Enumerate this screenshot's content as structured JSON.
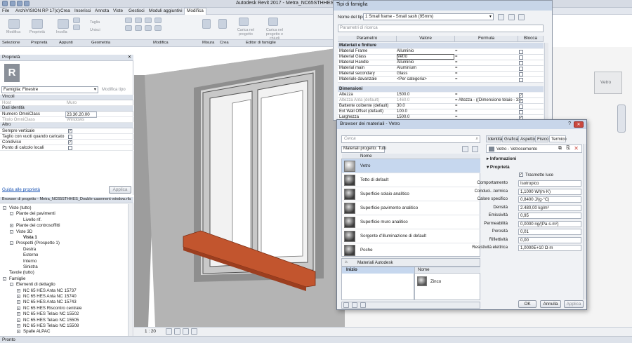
{
  "window": {
    "title": "Autodesk Revit 2017 -",
    "file_title": "Metra_NC65STHHES_Double-casement"
  },
  "menu_tabs": [
    "File",
    "ArchiVISION RP 17(c)",
    "Crea",
    "Inserisci",
    "Annota",
    "Viste",
    "Gestisci",
    "Moduli aggiuntivi",
    "Modifica"
  ],
  "ribbon": {
    "buttons": [
      "Modifica",
      "Proprietà",
      "Incolla",
      "Taglia",
      "Unisci",
      "Carica nel progetto",
      "Carica nel progetto e chiudi"
    ],
    "panels": [
      "Selezione",
      "Proprietà",
      "Appunti",
      "Geometria",
      "Modifica",
      "Misura",
      "Crea",
      "Editor di famiglie"
    ]
  },
  "properties": {
    "header": "Proprietà",
    "family_selector": "Famiglia: Finestre",
    "edit_type": "Modifica tipo",
    "groups": {
      "vincoli": "Vincoli",
      "dati": "Dati identità",
      "altro": "Altro"
    },
    "rows": {
      "host": {
        "label": "Host",
        "value": "Muro"
      },
      "numero": {
        "label": "Numero OmniClass",
        "value": "23.30.20.00"
      },
      "titolo": {
        "label": "Titolo OmniClass",
        "value": "Windows"
      },
      "sempre": {
        "label": "Sempre verticale",
        "checked": true
      },
      "taglio": {
        "label": "Taglio con vuoti quando caricato",
        "checked": false
      },
      "condiviso": {
        "label": "Condiviso",
        "checked": true
      },
      "punto": {
        "label": "Punto di calcolo locali",
        "checked": false
      }
    },
    "help_link": "Guida alle proprietà",
    "apply": "Applica"
  },
  "project_browser": {
    "header": "Browser di progetto - Metra_NC65STHHES_Double-casement-window.rfa",
    "items": [
      {
        "label": "Viste (tutto)",
        "indent": 0,
        "toggle": "-"
      },
      {
        "label": "Piante dei pavimenti",
        "indent": 1,
        "toggle": "-"
      },
      {
        "label": "Livello rif.",
        "indent": 2,
        "toggle": ""
      },
      {
        "label": "Piante dei controsoffitti",
        "indent": 1,
        "toggle": "+"
      },
      {
        "label": "Viste 3D",
        "indent": 1,
        "toggle": "-"
      },
      {
        "label": "Vista 1",
        "indent": 2,
        "toggle": "",
        "bold": true
      },
      {
        "label": "Prospetti (Prospetto 1)",
        "indent": 1,
        "toggle": "-"
      },
      {
        "label": "Destra",
        "indent": 2,
        "toggle": ""
      },
      {
        "label": "Esterno",
        "indent": 2,
        "toggle": ""
      },
      {
        "label": "Interno",
        "indent": 2,
        "toggle": ""
      },
      {
        "label": "Sinistra",
        "indent": 2,
        "toggle": ""
      },
      {
        "label": "Tavole (tutto)",
        "indent": 0,
        "toggle": ""
      },
      {
        "label": "Famiglie",
        "indent": 0,
        "toggle": "-"
      },
      {
        "label": "Elementi di dettaglio",
        "indent": 1,
        "toggle": "-"
      },
      {
        "label": "NC 65 HES Anta NC 15737",
        "indent": 2,
        "toggle": "+"
      },
      {
        "label": "NC 65 HES Anta NC 15740",
        "indent": 2,
        "toggle": "+"
      },
      {
        "label": "NC 65 HES Anta NC 15743",
        "indent": 2,
        "toggle": "+"
      },
      {
        "label": "NC 65 HES Riscontro centrale",
        "indent": 2,
        "toggle": "+"
      },
      {
        "label": "NC 65 HES Telaio NC 15502",
        "indent": 2,
        "toggle": "+"
      },
      {
        "label": "NC 65 HES Telaio NC 15505",
        "indent": 2,
        "toggle": "+"
      },
      {
        "label": "NC 65 HES Telaio NC 15508",
        "indent": 2,
        "toggle": "+"
      },
      {
        "label": "Spalle ALPAC",
        "indent": 2,
        "toggle": "+"
      }
    ]
  },
  "status": {
    "text": "Pronto",
    "scale": "1 : 20"
  },
  "type_dialog": {
    "title": "Tipi di famiglia",
    "type_label": "Nome del tipo:",
    "type_value": "1 Small frame - Small sash (95mm)",
    "search_placeholder": "Parametri di ricerca",
    "columns": [
      "Parametro",
      "Valore",
      "Formula",
      "Blocca"
    ],
    "group1": "Materiali e finiture",
    "rows1": [
      {
        "p": "Material Frame",
        "v": "Alluminio",
        "f": "="
      },
      {
        "p": "Material Glass",
        "v": "Vetro",
        "f": "="
      },
      {
        "p": "Material Handle",
        "v": "Alluminio",
        "f": "="
      },
      {
        "p": "Material main",
        "v": "Aluminium",
        "f": "="
      },
      {
        "p": "Material secondary",
        "v": "Glass",
        "f": "="
      },
      {
        "p": "Materiale davanzale",
        "v": "<Per categoria>",
        "f": "="
      }
    ],
    "group2": "Dimensioni",
    "rows2": [
      {
        "p": "Altezza",
        "v": "1500.0",
        "f": "=",
        "lock": true
      },
      {
        "p": "Altezza Anta (default)",
        "v": "1460.0",
        "f": "= Altezza - ((Dimensione telaio - 33",
        "lock": true
      },
      {
        "p": "Battente coibente (default)",
        "v": "30.0",
        "f": "=",
        "lock": false
      },
      {
        "p": "Ext Wall Offset (default)",
        "v": "100.0",
        "f": "=",
        "lock": false
      },
      {
        "p": "Larghezza",
        "v": "1500.0",
        "f": "=",
        "lock": true
      }
    ]
  },
  "material_browser": {
    "title": "Browser dei materiali - Vetro",
    "search_placeholder": "Cerca",
    "filter": "Materiali progetto: Tutti",
    "list_header": "Nome",
    "materials": [
      "Vetro",
      "Tetto di default",
      "Superficie solaio analitico",
      "Superficie pavimento analitico",
      "Superficie muro analitico",
      "Sorgente d'illuminazione di default",
      "Poche"
    ],
    "selected": "Vetro",
    "library": "Materiali Autodesk",
    "library_node": "Inizio",
    "library_header": "Nome",
    "library_item": "Zinco",
    "tabs": [
      "Identità",
      "Grafica",
      "Aspetto",
      "Fisico",
      "Termico"
    ],
    "asset_name": "Vetro - Vetrocemento",
    "section_info": "Informazioni",
    "section_props": "Proprietà",
    "transmit_light": "Trasmette luce",
    "properties": [
      {
        "k": "Comportamento",
        "v": "Isotropico"
      },
      {
        "k": "Conduci...termica",
        "v": "1,1000 W/(m·K)"
      },
      {
        "k": "Calore specifico",
        "v": "0,8400 J/(g·°C)"
      },
      {
        "k": "Densità",
        "v": "2.480,00 kg/m³"
      },
      {
        "k": "Emissività",
        "v": "0,95"
      },
      {
        "k": "Permeabilità",
        "v": "0,0000 ng/(Pa·s·m²)"
      },
      {
        "k": "Porosità",
        "v": "0,01"
      },
      {
        "k": "Riflettività",
        "v": "0,00"
      },
      {
        "k": "Resistività elettrica",
        "v": "1,0000E+10 Ω·m"
      }
    ],
    "ok": "OK",
    "cancel": "Annulla",
    "apply": "Applica"
  },
  "viewcube": {
    "face": "Vetro"
  },
  "colors": {
    "accent": "#c6d7ee",
    "header": "#dde3ec",
    "window_sill": "#c2552e"
  }
}
